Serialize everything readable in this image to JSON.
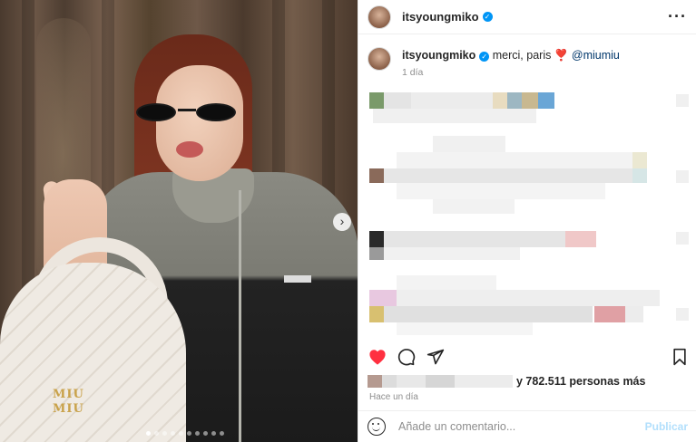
{
  "post": {
    "username": "itsyoungmiko",
    "verified": true,
    "more_icon": "more-options-icon"
  },
  "caption": {
    "username": "itsyoungmiko",
    "text": "merci, paris",
    "emoji": "❣️",
    "mention": "@miumiu",
    "time": "1 día"
  },
  "media": {
    "bag_brand_line1": "MIU",
    "bag_brand_line2": "MIU",
    "carousel_count": 10,
    "carousel_active_index": 0,
    "next_icon": "chevron-right-icon"
  },
  "actions": {
    "like_icon": "heart-filled-icon",
    "comment_icon": "comment-icon",
    "share_icon": "share-icon",
    "save_icon": "bookmark-icon",
    "liked": true,
    "like_color": "#ff3040"
  },
  "likes": {
    "count_text": "y 782.511 personas más",
    "time": "Hace un día"
  },
  "comment_box": {
    "placeholder": "Añade un comentario...",
    "publish_label": "Publicar",
    "emoji_icon": "emoji-icon"
  },
  "colors": {
    "accent": "#0095f6",
    "publish_disabled": "#b2dffc",
    "secondary_text": "#8e8e8e"
  }
}
